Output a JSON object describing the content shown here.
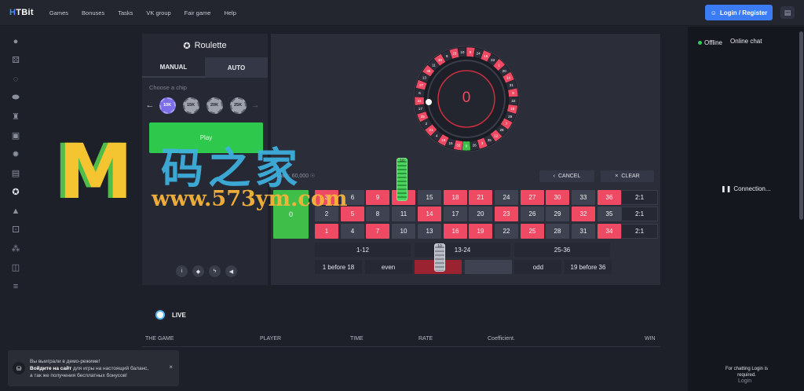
{
  "header": {
    "logo_main": "H",
    "logo_rest": "TBit",
    "nav": [
      "Games",
      "Bonuses",
      "Tasks",
      "VK group",
      "Fair game",
      "Help"
    ],
    "login_label": "Login / Register",
    "login_icon": "user-icon",
    "chat_icon": "chat-icon"
  },
  "sidebar": {
    "icons": [
      "bomb-icon",
      "dice-icon",
      "spinner-icon",
      "coins-icon",
      "tower-icon",
      "slot-icon",
      "gear-wheel-icon",
      "cards-icon",
      "roulette-icon",
      "chart-icon",
      "dice-box-icon",
      "pyramid-icon",
      "box-icon",
      "stack-icon"
    ]
  },
  "game": {
    "title": "Roulette",
    "tab_manual": "MANUAL",
    "tab_auto": "AUTO",
    "choose_chip": "Choose a chip",
    "chips": [
      "10K",
      "15K",
      "20K",
      "25K"
    ],
    "selected_chip": "10K",
    "play_label": "Play",
    "footer_icons": [
      "info-icon",
      "shield-icon",
      "lightning-icon",
      "sound-icon"
    ]
  },
  "wheel": {
    "result": "0",
    "numbers": [
      0,
      32,
      15,
      19,
      4,
      21,
      2,
      25,
      17,
      34,
      6,
      27,
      13,
      36,
      11,
      30,
      8,
      23,
      10,
      5,
      24,
      16,
      33,
      1,
      20,
      14,
      31,
      9,
      22,
      18,
      29,
      7,
      28,
      12,
      35,
      3,
      26
    ]
  },
  "board": {
    "rate_label": "Rate: 60,000 ☉",
    "cancel_label": "CANCEL",
    "clear_label": "CLEAR",
    "zero": "0",
    "rows": [
      [
        {
          "n": "3",
          "c": "red"
        },
        {
          "n": "6",
          "c": "black"
        },
        {
          "n": "9",
          "c": "red"
        },
        {
          "n": "12",
          "c": "red"
        },
        {
          "n": "15",
          "c": "black"
        },
        {
          "n": "18",
          "c": "red"
        },
        {
          "n": "21",
          "c": "red"
        },
        {
          "n": "24",
          "c": "black"
        },
        {
          "n": "27",
          "c": "red"
        },
        {
          "n": "30",
          "c": "red"
        },
        {
          "n": "33",
          "c": "black"
        },
        {
          "n": "36",
          "c": "red"
        }
      ],
      [
        {
          "n": "2",
          "c": "black"
        },
        {
          "n": "5",
          "c": "red"
        },
        {
          "n": "8",
          "c": "black"
        },
        {
          "n": "11",
          "c": "black"
        },
        {
          "n": "14",
          "c": "red"
        },
        {
          "n": "17",
          "c": "black"
        },
        {
          "n": "20",
          "c": "black"
        },
        {
          "n": "23",
          "c": "red"
        },
        {
          "n": "26",
          "c": "black"
        },
        {
          "n": "29",
          "c": "black"
        },
        {
          "n": "32",
          "c": "red"
        },
        {
          "n": "35",
          "c": "black"
        }
      ],
      [
        {
          "n": "1",
          "c": "red"
        },
        {
          "n": "4",
          "c": "black"
        },
        {
          "n": "7",
          "c": "red"
        },
        {
          "n": "10",
          "c": "black"
        },
        {
          "n": "13",
          "c": "black"
        },
        {
          "n": "16",
          "c": "red"
        },
        {
          "n": "19",
          "c": "red"
        },
        {
          "n": "22",
          "c": "black"
        },
        {
          "n": "25",
          "c": "red"
        },
        {
          "n": "28",
          "c": "black"
        },
        {
          "n": "31",
          "c": "black"
        },
        {
          "n": "34",
          "c": "red"
        }
      ]
    ],
    "columns": [
      "2:1",
      "2:1",
      "2:1"
    ],
    "dozens": [
      "1-12",
      "13-24",
      "25-36"
    ],
    "outside": [
      "1 before 18",
      "even",
      "",
      "",
      "odd",
      "19 before 36"
    ],
    "stack_top_label": "10",
    "stack_bottom_label": "10"
  },
  "live": {
    "label": "LIVE",
    "columns": [
      "THE GAME",
      "PLAYER",
      "TIME",
      "RATE",
      "Coefficient.",
      "WIN"
    ]
  },
  "chat": {
    "status": "Offline",
    "title": "Online chat",
    "connection": "Connection...",
    "note": "For chatting Login is required.",
    "login": "Login"
  },
  "toast": {
    "line1": "Вы выиграли в демо-режиме!",
    "line2_bold": "Войдите на сайт",
    "line2_rest": " для игры на настоящий баланс,",
    "line3": "а так же получения бесплатных бонусов!",
    "close": "×"
  },
  "watermark": {
    "letter": "M",
    "chinese": "码之家",
    "url": "www.573ym.com"
  },
  "colors": {
    "red": "#ee4a63",
    "black": "#3f4250",
    "green": "#3fbf4a",
    "accent": "#3b7cf4",
    "play": "#2ec84c"
  }
}
